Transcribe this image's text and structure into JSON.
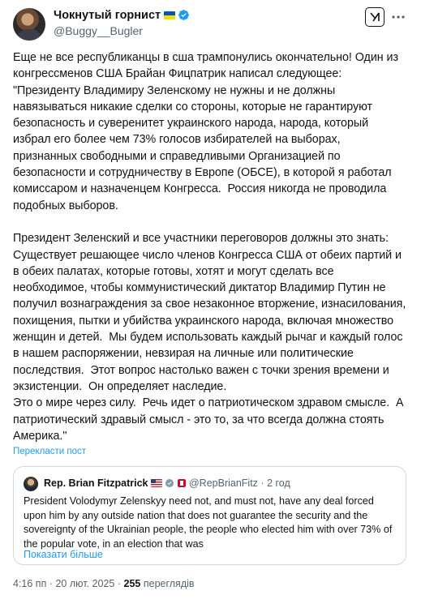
{
  "author": {
    "name": "Чокнутый горнист",
    "handle": "@Buggy__Bugler",
    "flag_icon": "ukraine-flag-icon",
    "verified_icon": "verified-badge-icon"
  },
  "actions": {
    "grok_icon": "grok-icon",
    "more_icon": "more-options-icon"
  },
  "tweet": {
    "text": "Еще не все республиканцы в сша трампонулись окончательно! Один из конгрессменов США Брайан Фицпатрик написал следующее:\n\"Президенту Владимиру Зеленскому не нужны и не должны навязываться никакие сделки со стороны, которые не гарантируют безопасность и суверенитет украинского народа, народа, который избрал его более чем 73% голосов избирателей на выборах, признанных свободными и справедливыми Организацией по безопасности и сотрудничеству в Европе (ОБСЕ), в которой я работал комиссаром и назначенцем Конгресса.  Россия никогда не проводила подобных выборов.\n\nПрезидент Зеленский и все участники переговоров должны это знать: Существует решающее число членов Конгресса США от обеих партий и в обеих палатах, которые готовы, хотят и могут сделать все необходимое, чтобы коммунистический диктатор Владимир Путин не получил вознаграждения за свое незаконное вторжение, изнасилования, похищения, пытки и убийства украинского народа, включая множество женщин и детей.  Мы будем использовать каждый рычаг и каждый голос в нашем распоряжении, невзирая на личные или политические последствия.  Этот вопрос настолько важен с точки зрения времени и экзистенции.  Он определяет наследие.\nЭто о мире через силу.  Речь идет о патриотическом здравом смысле.  А патриотический здравый смысл - это то, за что всегда должна стоять Америка.\"",
    "translate_label": "Перекласти пост"
  },
  "quote": {
    "name": "Rep. Brian Fitzpatrick",
    "handle": "@RepBrianFitz",
    "time": "2 год",
    "separator": "·",
    "text": "President Volodymyr Zelenskyy need not, and must not, have any deal forced upon him by any outside nation that does not guarantee the security and the sovereignty of the Ukrainian people, the people who elected him with over 73% of the popular vote, in an election that was",
    "show_more": "Показати більше",
    "icons": [
      "us-flag-icon",
      "verified-grey-icon",
      "government-badge-icon"
    ]
  },
  "footer": {
    "time": "4:16 пп",
    "date": "20 лют. 2025",
    "separator": "·",
    "views_count": "255",
    "views_label": "переглядів"
  },
  "colors": {
    "link": "#1d9bf0",
    "muted": "#536471",
    "text": "#0f1419",
    "border": "#cfd9de"
  }
}
